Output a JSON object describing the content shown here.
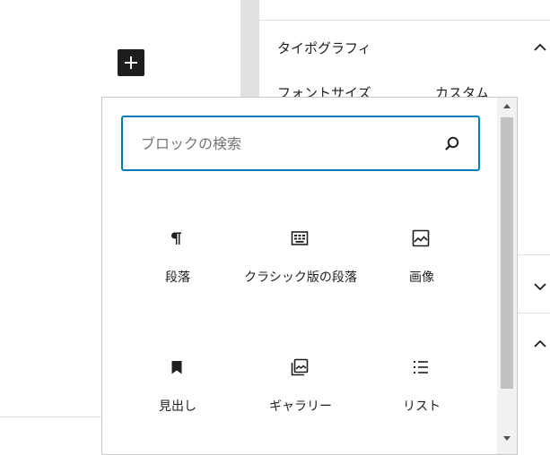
{
  "sidebar": {
    "typography_title": "タイポグラフィ",
    "font_size_label": "フォントサイズ",
    "custom_label": "カスタム"
  },
  "inserter": {
    "search_placeholder": "ブロックの検索",
    "blocks": [
      {
        "label": "段落",
        "icon": "paragraph-icon"
      },
      {
        "label": "クラシック版の段落",
        "icon": "classic-icon"
      },
      {
        "label": "画像",
        "icon": "image-icon"
      },
      {
        "label": "見出し",
        "icon": "heading-icon"
      },
      {
        "label": "ギャラリー",
        "icon": "gallery-icon"
      },
      {
        "label": "リスト",
        "icon": "list-icon"
      }
    ]
  },
  "colors": {
    "accent": "#007cba",
    "dark": "#1e1e1e",
    "border": "#e0e0e0"
  }
}
